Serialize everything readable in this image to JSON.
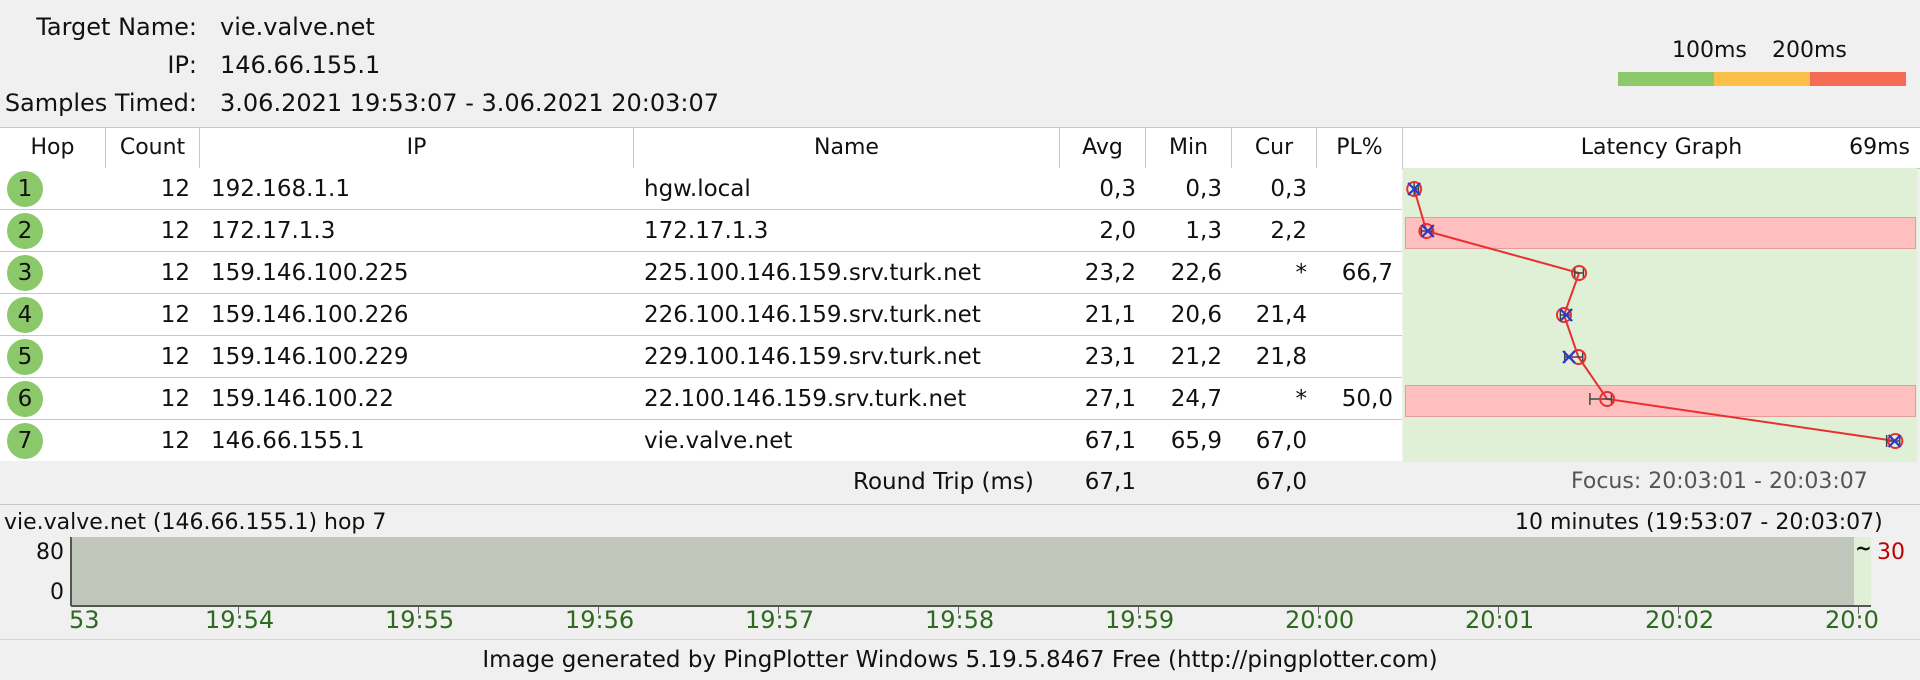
{
  "header": {
    "target_label": "Target Name:",
    "target_value": "vie.valve.net",
    "ip_label": "IP:",
    "ip_value": "146.66.155.1",
    "samples_label": "Samples Timed:",
    "samples_value": "3.06.2021 19:53:07 - 3.06.2021 20:03:07",
    "scale_100": "100ms",
    "scale_200": "200ms",
    "scale_colors": [
      "#8dc86a",
      "#fbbf4a",
      "#f56c55"
    ]
  },
  "columns": {
    "hop": "Hop",
    "count": "Count",
    "ip": "IP",
    "name": "Name",
    "avg": "Avg",
    "min": "Min",
    "cur": "Cur",
    "pl": "PL%",
    "graph": "Latency Graph",
    "graph_max": "69ms"
  },
  "rows": [
    {
      "hop": "1",
      "count": "12",
      "ip": "192.168.1.1",
      "name": "hgw.local",
      "avg": "0,3",
      "min": "0,3",
      "cur": "0,3",
      "pl": "",
      "avg_ms": 0.3,
      "min_ms": 0.3,
      "cur_ms": 0.3,
      "loss": false
    },
    {
      "hop": "2",
      "count": "12",
      "ip": "172.17.1.3",
      "name": "172.17.1.3",
      "avg": "2,0",
      "min": "1,3",
      "cur": "2,2",
      "pl": "",
      "avg_ms": 2.0,
      "min_ms": 1.3,
      "cur_ms": 2.2,
      "loss": false
    },
    {
      "hop": "3",
      "count": "12",
      "ip": "159.146.100.225",
      "name": "225.100.146.159.srv.turk.net",
      "avg": "23,2",
      "min": "22,6",
      "cur": "*",
      "pl": "66,7",
      "avg_ms": 23.2,
      "min_ms": 22.6,
      "cur_ms": null,
      "loss": true
    },
    {
      "hop": "4",
      "count": "12",
      "ip": "159.146.100.226",
      "name": "226.100.146.159.srv.turk.net",
      "avg": "21,1",
      "min": "20,6",
      "cur": "21,4",
      "pl": "",
      "avg_ms": 21.1,
      "min_ms": 20.6,
      "cur_ms": 21.4,
      "loss": false
    },
    {
      "hop": "5",
      "count": "12",
      "ip": "159.146.100.229",
      "name": "229.100.146.159.srv.turk.net",
      "avg": "23,1",
      "min": "21,2",
      "cur": "21,8",
      "pl": "",
      "avg_ms": 23.1,
      "min_ms": 21.2,
      "cur_ms": 21.8,
      "loss": false
    },
    {
      "hop": "6",
      "count": "12",
      "ip": "159.146.100.22",
      "name": "22.100.146.159.srv.turk.net",
      "avg": "27,1",
      "min": "24,7",
      "cur": "*",
      "pl": "50,0",
      "avg_ms": 27.1,
      "min_ms": 24.7,
      "cur_ms": null,
      "loss": true
    },
    {
      "hop": "7",
      "count": "12",
      "ip": "146.66.155.1",
      "name": "vie.valve.net",
      "avg": "67,1",
      "min": "65,9",
      "cur": "67,0",
      "pl": "",
      "avg_ms": 67.1,
      "min_ms": 65.9,
      "cur_ms": 67.0,
      "loss": false
    }
  ],
  "round_trip": {
    "label": "Round Trip (ms)",
    "avg": "67,1",
    "cur": "67,0",
    "focus": "Focus: 20:03:01 - 20:03:07"
  },
  "timeline": {
    "title": "vie.valve.net (146.66.155.1) hop 7",
    "range": "10 minutes (19:53:07 - 20:03:07)",
    "y_max": "80",
    "y_min": "0",
    "right_value": "30",
    "x_labels": [
      "53",
      "19:54",
      "19:55",
      "19:56",
      "19:57",
      "19:58",
      "19:59",
      "20:00",
      "20:01",
      "20:02",
      "20:0"
    ]
  },
  "footer": "Image generated by PingPlotter Windows 5.19.5.8467 Free (http://pingplotter.com)"
}
